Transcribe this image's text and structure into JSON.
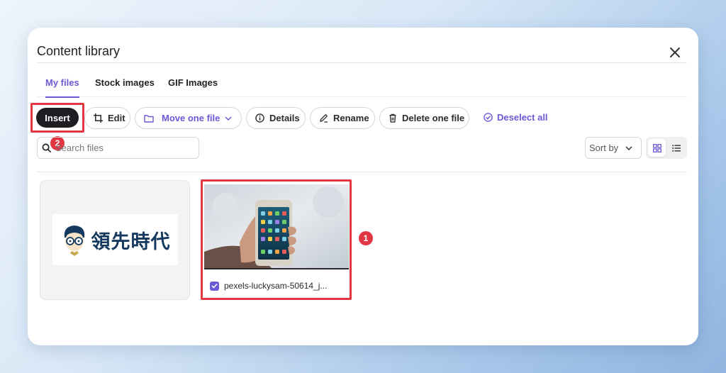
{
  "dialog": {
    "title": "Content library",
    "close_icon": "close-icon"
  },
  "tabs": [
    {
      "label": "My files",
      "active": true
    },
    {
      "label": "Stock images",
      "active": false
    },
    {
      "label": "GIF Images",
      "active": false
    }
  ],
  "toolbar": {
    "insert_label": "Insert",
    "edit_label": "Edit",
    "move_label": "Move one file",
    "details_label": "Details",
    "rename_label": "Rename",
    "delete_label": "Delete one file",
    "deselect_label": "Deselect all"
  },
  "search": {
    "placeholder": "Search files",
    "value": ""
  },
  "sort": {
    "label": "Sort by"
  },
  "view": {
    "mode": "grid"
  },
  "files": [
    {
      "logo_text": "領先時代",
      "selected": false
    },
    {
      "name": "pexels-luckysam-50614_j...",
      "selected": true
    }
  ],
  "annotations": {
    "badge_1": "1",
    "badge_2": "2"
  },
  "colors": {
    "accent": "#6a5ad6",
    "highlight": "#e23640",
    "primary_button": "#1d1d22"
  }
}
